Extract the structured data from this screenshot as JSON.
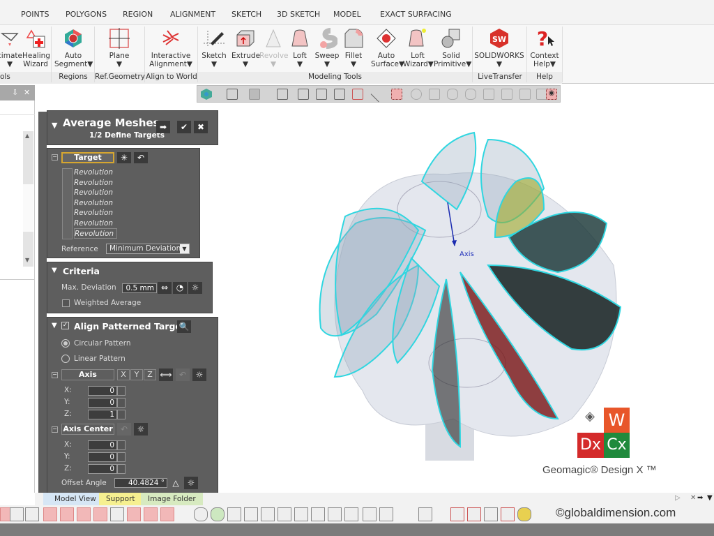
{
  "menu_tabs": [
    "POINTS",
    "POLYGONS",
    "REGION",
    "ALIGNMENT",
    "SKETCH",
    "3D SKETCH",
    "MODEL",
    "EXACT SURFACING"
  ],
  "ribbon": {
    "buttons": [
      {
        "label": "cimate",
        "sub": "▼"
      },
      {
        "label": "Healing",
        "sub": "Wizard"
      },
      {
        "label": "Auto",
        "sub": "Segment▼"
      },
      {
        "label": "Plane",
        "sub": "▼"
      },
      {
        "label": "Interactive",
        "sub": "Alignment▼"
      },
      {
        "label": "Sketch",
        "sub": "▼"
      },
      {
        "label": "Extrude",
        "sub": "▼"
      },
      {
        "label": "Revolve",
        "sub": "▼"
      },
      {
        "label": "Loft",
        "sub": "▼"
      },
      {
        "label": "Sweep",
        "sub": "▼"
      },
      {
        "label": "Fillet",
        "sub": "▼"
      },
      {
        "label": "Auto",
        "sub": "Surface▼"
      },
      {
        "label": "Loft",
        "sub": "Wizard▼"
      },
      {
        "label": "Solid",
        "sub": "Primitive▼"
      },
      {
        "label": "SOLIDWORKS",
        "sub": "▼"
      },
      {
        "label": "Context",
        "sub": "Help▼"
      }
    ],
    "groups": [
      "ols",
      "Regions",
      "Ref.Geometry",
      "Align to World",
      "Modeling Tools",
      "LiveTransfer",
      "Help"
    ]
  },
  "left_panel": {
    "pin": "⇩",
    "close": "✕"
  },
  "dialog": {
    "title": "Average Meshes",
    "step": "1/2 Define Targets",
    "target": {
      "label": "Target",
      "items": [
        "Revolution",
        "Revolution",
        "Revolution",
        "Revolution",
        "Revolution",
        "Revolution",
        "Revolution"
      ],
      "reference_label": "Reference",
      "reference_value": "Minimum Deviation"
    },
    "criteria": {
      "title": "Criteria",
      "max_dev_label": "Max. Deviation",
      "max_dev_value": "0.5 mm",
      "weighted_label": "Weighted Average",
      "weighted_checked": false
    },
    "align": {
      "title": "Align Patterned Targets",
      "checked": true,
      "circular": "Circular Pattern",
      "linear": "Linear Pattern",
      "selected": "Circular Pattern",
      "axis_label": "Axis",
      "axis_buttons": [
        "X",
        "Y",
        "Z"
      ],
      "axis": {
        "x_label": "X:",
        "x": "0",
        "y_label": "Y:",
        "y": "0",
        "z_label": "Z:",
        "z": "1"
      },
      "center_label": "Axis Center",
      "center": {
        "x_label": "X:",
        "x": "0",
        "y_label": "Y:",
        "y": "0",
        "z_label": "Z:",
        "z": "0"
      },
      "offset_label": "Offset Angle",
      "offset_value": "40.4824 °"
    }
  },
  "viewport": {
    "axis_label": "Axis",
    "brand": "Geomagic® Design X ™",
    "logo": {
      "w": "W",
      "dx": "Dx",
      "cx": "Cx"
    },
    "colors": {
      "blade_edge": "#2fd6e0",
      "logo_w": "#e8562a",
      "logo_dx": "#d42a2a",
      "logo_cx": "#1f8a3c"
    }
  },
  "bottom_tabs": [
    "Model View",
    "Support",
    "Image Folder"
  ],
  "watermark": "©globaldimension.com"
}
